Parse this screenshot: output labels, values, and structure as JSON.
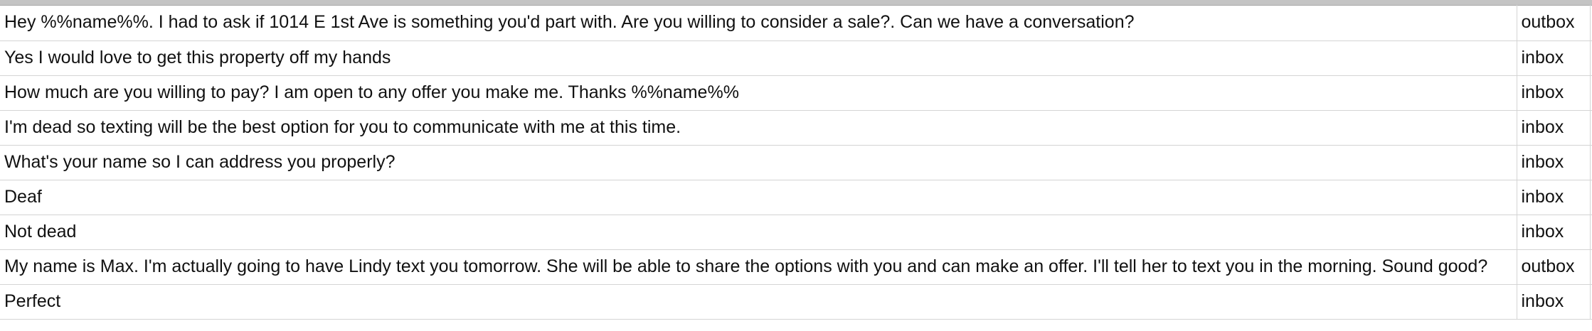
{
  "sheet": {
    "rows": [
      {
        "message": "Hey %%name%%. I had to ask if 1014 E 1st Ave is something you'd part with. Are you willing to consider a sale?. Can we have a conversation?",
        "direction": "outbox"
      },
      {
        "message": "Yes I would love to get this property off my hands",
        "direction": "inbox"
      },
      {
        "message": "How much are you willing to pay? I am open to any offer you make me. Thanks %%name%%",
        "direction": "inbox"
      },
      {
        "message": "I'm dead so texting will be the best option for you to communicate with me at this time.",
        "direction": "inbox"
      },
      {
        "message": "What's your name so I can address you properly?",
        "direction": "inbox"
      },
      {
        "message": "Deaf",
        "direction": "inbox"
      },
      {
        "message": "Not dead",
        "direction": "inbox"
      },
      {
        "message": "My name is Max. I'm actually going to have Lindy text you tomorrow. She will be able to share the options with you and can make an offer. I'll tell her to text you in the morning. Sound good?",
        "direction": "outbox"
      },
      {
        "message": "Perfect",
        "direction": "inbox"
      }
    ]
  }
}
